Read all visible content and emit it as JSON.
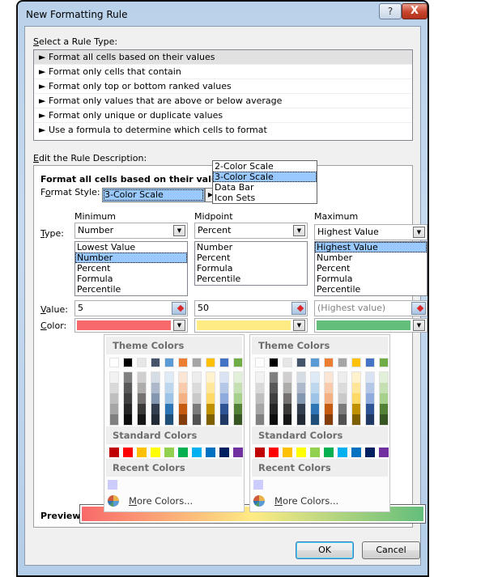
{
  "window": {
    "title": "New Formatting Rule",
    "help_label": "?",
    "close_label": "X"
  },
  "rule_type": {
    "label": "Select a Rule Type:",
    "label_accesskey": "S",
    "label_rest": "elect a Rule Type:",
    "selected_index": 0,
    "items": [
      "► Format all cells based on their values",
      "► Format only cells that contain",
      "► Format only top or bottom ranked values",
      "► Format only values that are above or below average",
      "► Format only unique or duplicate values",
      "► Use a formula to determine which cells to format"
    ]
  },
  "description": {
    "label_accesskey": "E",
    "label_rest": "dit the Rule Description:",
    "heading": "Format all cells based on their values:",
    "format_style_label_pre": "F",
    "format_style_label_key": "o",
    "format_style_label_post": "rmat Style:",
    "format_style_value": "3-Color Scale",
    "format_style_options": [
      "2-Color Scale",
      "3-Color Scale",
      "Data Bar",
      "Icon Sets"
    ],
    "format_style_selected": "3-Color Scale"
  },
  "columns": {
    "type_label_key": "T",
    "type_label_rest": "ype:",
    "value_label_key": "V",
    "value_label_rest": "alue:",
    "color_label_key": "C",
    "color_label_rest": "olor:",
    "minimum": {
      "header": "Minimum",
      "type_value": "Number",
      "type_options": [
        "Lowest Value",
        "Number",
        "Percent",
        "Formula",
        "Percentile"
      ],
      "type_selected": "Number",
      "value": "5",
      "color": "#f8696b"
    },
    "midpoint": {
      "header": "Midpoint",
      "type_value": "Percent",
      "type_options": [
        "Number",
        "Percent",
        "Formula",
        "Percentile"
      ],
      "value": "50",
      "color": "#ffeb84"
    },
    "maximum": {
      "header": "Maximum",
      "type_value": "Highest Value",
      "type_options": [
        "Highest Value",
        "Number",
        "Percent",
        "Formula",
        "Percentile"
      ],
      "type_selected": "Highest Value",
      "value_placeholder": "(Highest value)",
      "color": "#63be7b"
    }
  },
  "palette": {
    "theme_header": "Theme Colors",
    "standard_header": "Standard Colors",
    "recent_header": "Recent Colors",
    "more_colors_key": "M",
    "more_colors_rest": "ore Colors...",
    "theme_top": [
      "#ffffff",
      "#000000",
      "#e7e6e6",
      "#44546a",
      "#5b9bd5",
      "#ed7d31",
      "#a5a5a5",
      "#ffc000",
      "#4472c4",
      "#70ad47"
    ],
    "theme_shades": [
      [
        "#f2f2f2",
        "#d9d9d9",
        "#bfbfbf",
        "#a6a6a6",
        "#808080"
      ],
      [
        "#808080",
        "#595959",
        "#404040",
        "#262626",
        "#0d0d0d"
      ],
      [
        "#d0cece",
        "#aeabab",
        "#757171",
        "#3b3838",
        "#171616"
      ],
      [
        "#d6dce4",
        "#adb9ca",
        "#8497b0",
        "#333f4f",
        "#222a35"
      ],
      [
        "#deebf6",
        "#bdd7ee",
        "#9dc3e6",
        "#2e75b5",
        "#1f4e79"
      ],
      [
        "#fbe5d5",
        "#f8cbad",
        "#f4b183",
        "#c55a11",
        "#843c0b"
      ],
      [
        "#ededed",
        "#dbdbdb",
        "#c9c9c9",
        "#7b7b7b",
        "#525252"
      ],
      [
        "#fff2cc",
        "#ffe699",
        "#ffd966",
        "#bf9000",
        "#7f6000"
      ],
      [
        "#dae3f3",
        "#b4c7e7",
        "#8faadc",
        "#2f5496",
        "#1f3864"
      ],
      [
        "#e2efd9",
        "#c5e0b3",
        "#a8d08d",
        "#538135",
        "#375623"
      ]
    ],
    "standard": [
      "#c00000",
      "#ff0000",
      "#ffc000",
      "#ffff00",
      "#92d050",
      "#00b050",
      "#00b0f0",
      "#0070c0",
      "#002060",
      "#7030a0"
    ],
    "recent": [
      "#ccccff"
    ]
  },
  "preview": {
    "label": "Preview:",
    "gradient": [
      "#f8696b",
      "#ffeb84",
      "#63be7b"
    ]
  },
  "buttons": {
    "ok": "OK",
    "cancel": "Cancel"
  }
}
